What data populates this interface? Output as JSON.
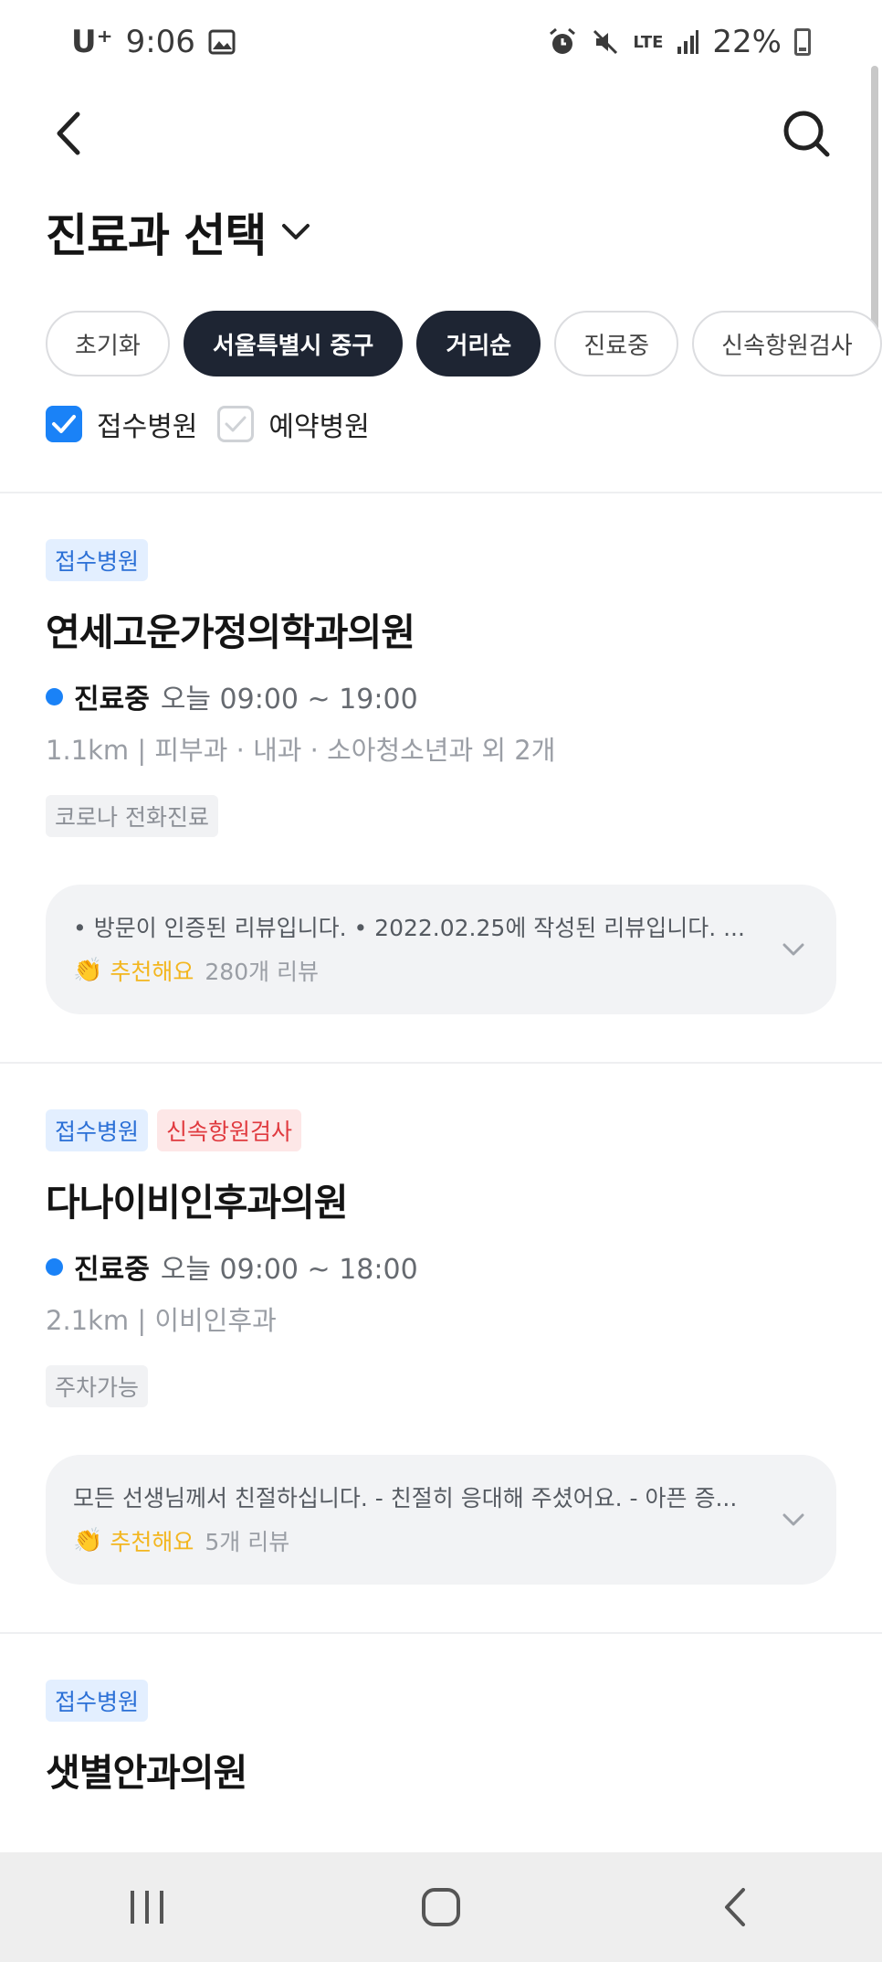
{
  "status_bar": {
    "carrier": "U⁺",
    "time": "9:06",
    "network": "LTE",
    "battery": "22%"
  },
  "header": {
    "title": "진료과 선택"
  },
  "filters": {
    "chips": [
      "초기화",
      "서울특별시 중구",
      "거리순",
      "진료중",
      "신속항원검사"
    ]
  },
  "checkboxes": {
    "reception": {
      "label": "접수병원",
      "checked": true
    },
    "reservation": {
      "label": "예약병원",
      "checked": false
    }
  },
  "hospitals": [
    {
      "tags": [
        "접수병원"
      ],
      "name": "연세고운가정의학과의원",
      "status": "진료중",
      "hours": "오늘 09:00 ~ 19:00",
      "meta": "1.1km | 피부과 · 내과 · 소아청소년과 외 2개",
      "feature": "코로나 전화진료",
      "review_text": "• 방문이 인증된 리뷰입니다. • 2022.02.25에 작성된 리뷰입니다. ...",
      "recommend": "추천해요",
      "review_count": "280개 리뷰"
    },
    {
      "tags": [
        "접수병원",
        "신속항원검사"
      ],
      "name": "다나이비인후과의원",
      "status": "진료중",
      "hours": "오늘 09:00 ~ 18:00",
      "meta": "2.1km | 이비인후과",
      "feature": "주차가능",
      "review_text": "모든 선생님께서 친절하십니다. - 친절히 응대해 주셨어요. - 아픈 증...",
      "recommend": "추천해요",
      "review_count": "5개 리뷰"
    },
    {
      "tags": [
        "접수병원"
      ],
      "name": "샛별안과의원"
    }
  ],
  "colors": {
    "accent_blue": "#1a82f7",
    "chip_dark": "#1e2533",
    "recommend_yellow": "#f3b61f"
  }
}
